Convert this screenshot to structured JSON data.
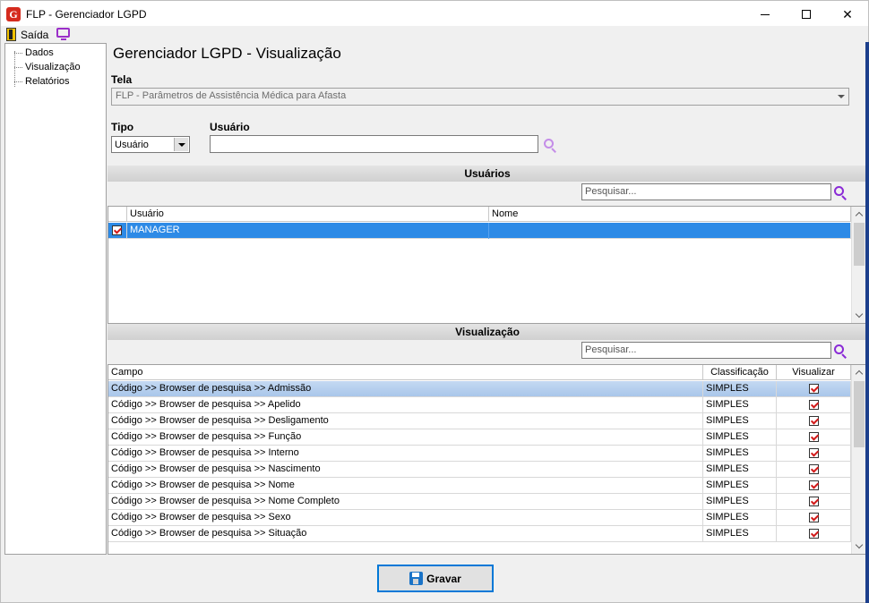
{
  "window": {
    "title": "FLP - Gerenciador LGPD",
    "logo_letter": "G",
    "minimize": "—",
    "close": "✕"
  },
  "menu": {
    "exit_label": "Saída"
  },
  "sidebar": {
    "items": [
      {
        "label": "Dados"
      },
      {
        "label": "Visualização"
      },
      {
        "label": "Relatórios"
      }
    ]
  },
  "main": {
    "title": "Gerenciador LGPD - Visualização",
    "tela_label": "Tela",
    "tela_value": "FLP - Parâmetros de Assistência Médica para Afasta",
    "tipo_label": "Tipo",
    "tipo_value": "Usuário",
    "usuario_label": "Usuário",
    "usuario_value": ""
  },
  "users_section": {
    "header": "Usuários",
    "search_placeholder": "Pesquisar...",
    "columns": [
      "Usuário",
      "Nome"
    ],
    "rows": [
      {
        "checked": true,
        "usuario": "MANAGER",
        "nome": ""
      }
    ]
  },
  "view_section": {
    "header": "Visualização",
    "search_placeholder": "Pesquisar...",
    "columns": [
      "Campo",
      "Classificação",
      "Visualizar"
    ],
    "rows": [
      {
        "campo": "Código >> Browser de pesquisa >> Admissão",
        "classificacao": "SIMPLES",
        "visualizar": true
      },
      {
        "campo": "Código >> Browser de pesquisa >> Apelido",
        "classificacao": "SIMPLES",
        "visualizar": true
      },
      {
        "campo": "Código >> Browser de pesquisa >> Desligamento",
        "classificacao": "SIMPLES",
        "visualizar": true
      },
      {
        "campo": "Código >> Browser de pesquisa >> Função",
        "classificacao": "SIMPLES",
        "visualizar": true
      },
      {
        "campo": "Código >> Browser de pesquisa >> Interno",
        "classificacao": "SIMPLES",
        "visualizar": true
      },
      {
        "campo": "Código >> Browser de pesquisa >> Nascimento",
        "classificacao": "SIMPLES",
        "visualizar": true
      },
      {
        "campo": "Código >> Browser de pesquisa >> Nome",
        "classificacao": "SIMPLES",
        "visualizar": true
      },
      {
        "campo": "Código >> Browser de pesquisa >> Nome Completo",
        "classificacao": "SIMPLES",
        "visualizar": true
      },
      {
        "campo": "Código >> Browser de pesquisa >> Sexo",
        "classificacao": "SIMPLES",
        "visualizar": true
      },
      {
        "campo": "Código >> Browser de pesquisa >> Situação",
        "classificacao": "SIMPLES",
        "visualizar": true
      }
    ]
  },
  "footer": {
    "save_label": "Gravar"
  },
  "colors": {
    "selection": "#2d8ae6",
    "highlight": "#c4d9f2",
    "accent_icon": "#8a2bd6",
    "check": "#d21a1a"
  },
  "icons": [
    "app-logo-icon",
    "exit-door-icon",
    "monitor-icon",
    "search-icon",
    "save-disk-icon",
    "chevron-down-icon",
    "chevron-up-icon"
  ]
}
